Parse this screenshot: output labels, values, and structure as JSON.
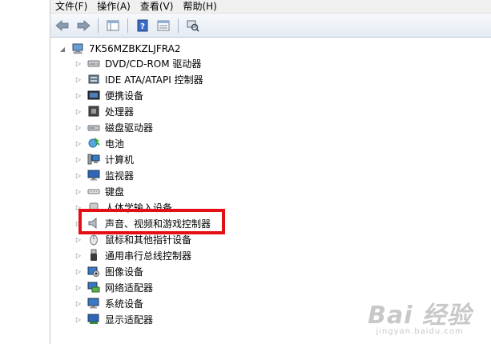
{
  "menubar": {
    "items": [
      "文件(F)",
      "操作(A)",
      "查看(V)",
      "帮助(H)"
    ]
  },
  "tree": {
    "root": "7K56MZBKZLJFRA2",
    "items": [
      {
        "label": "DVD/CD-ROM 驱动器",
        "icon": "dvd-drive-icon"
      },
      {
        "label": "IDE ATA/ATAPI 控制器",
        "icon": "ide-controller-icon"
      },
      {
        "label": "便携设备",
        "icon": "portable-device-icon"
      },
      {
        "label": "处理器",
        "icon": "processor-icon"
      },
      {
        "label": "磁盘驱动器",
        "icon": "disk-drive-icon"
      },
      {
        "label": "电池",
        "icon": "battery-icon"
      },
      {
        "label": "计算机",
        "icon": "computer-icon"
      },
      {
        "label": "监视器",
        "icon": "monitor-icon"
      },
      {
        "label": "键盘",
        "icon": "keyboard-icon"
      },
      {
        "label": "人体学输入设备",
        "icon": "hid-icon"
      },
      {
        "label": "声音、视频和游戏控制器",
        "icon": "speaker-icon"
      },
      {
        "label": "鼠标和其他指针设备",
        "icon": "mouse-icon"
      },
      {
        "label": "通用串行总线控制器",
        "icon": "usb-icon"
      },
      {
        "label": "图像设备",
        "icon": "camera-icon"
      },
      {
        "label": "网络适配器",
        "icon": "network-adapter-icon"
      },
      {
        "label": "系统设备",
        "icon": "system-device-icon"
      },
      {
        "label": "显示适配器",
        "icon": "display-adapter-icon"
      }
    ]
  },
  "highlight_item": "声音、视频和游戏控制器",
  "watermark": {
    "logo": "Bai 经验",
    "url": "jingyan.baidu.com"
  },
  "colors": {
    "highlight_border": "#e30f14",
    "toolbar_bg": "#e4ebf3"
  }
}
